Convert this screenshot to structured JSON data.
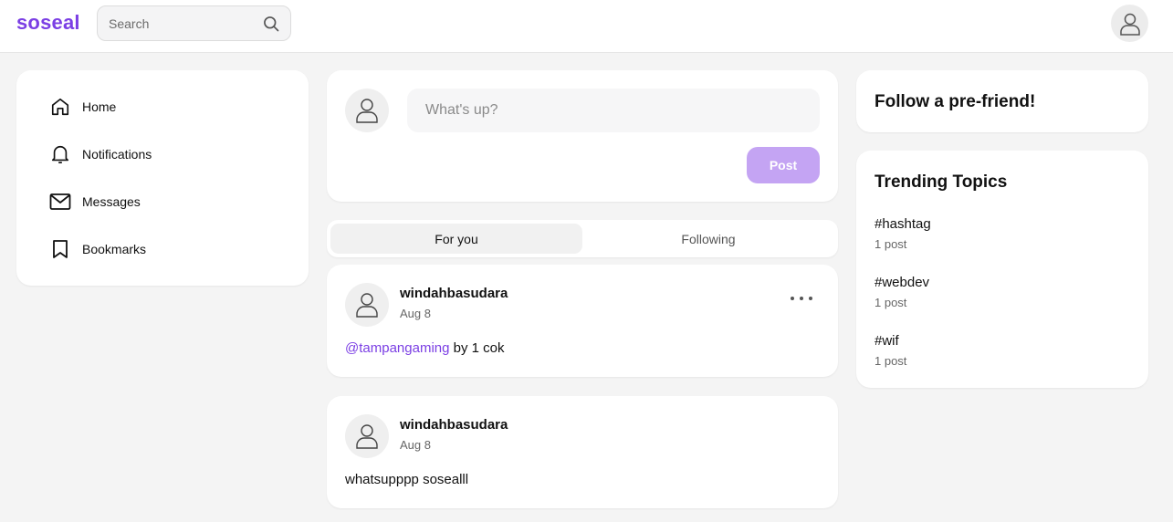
{
  "header": {
    "logo": "soseal",
    "search_placeholder": "Search"
  },
  "sidebar": {
    "items": [
      {
        "label": "Home",
        "icon": "home-icon"
      },
      {
        "label": "Notifications",
        "icon": "bell-icon"
      },
      {
        "label": "Messages",
        "icon": "mail-icon"
      },
      {
        "label": "Bookmarks",
        "icon": "bookmark-icon"
      }
    ]
  },
  "composer": {
    "placeholder": "What's up?",
    "post_label": "Post"
  },
  "tabs": {
    "for_you": "For you",
    "following": "Following"
  },
  "posts": [
    {
      "author": "windahbasudara",
      "date": "Aug 8",
      "mention": "@tampangaming",
      "text": " by 1 cok"
    },
    {
      "author": "windahbasudara",
      "date": "Aug 8",
      "text": "whatsupppp sosealll"
    }
  ],
  "follow": {
    "title": "Follow a pre-friend!"
  },
  "trending": {
    "title": "Trending Topics",
    "topics": [
      {
        "tag": "#hashtag",
        "count": "1 post"
      },
      {
        "tag": "#webdev",
        "count": "1 post"
      },
      {
        "tag": "#wif",
        "count": "1 post"
      }
    ]
  },
  "colors": {
    "brand": "#7b3fe4",
    "post_button": "#c4a4f3"
  }
}
